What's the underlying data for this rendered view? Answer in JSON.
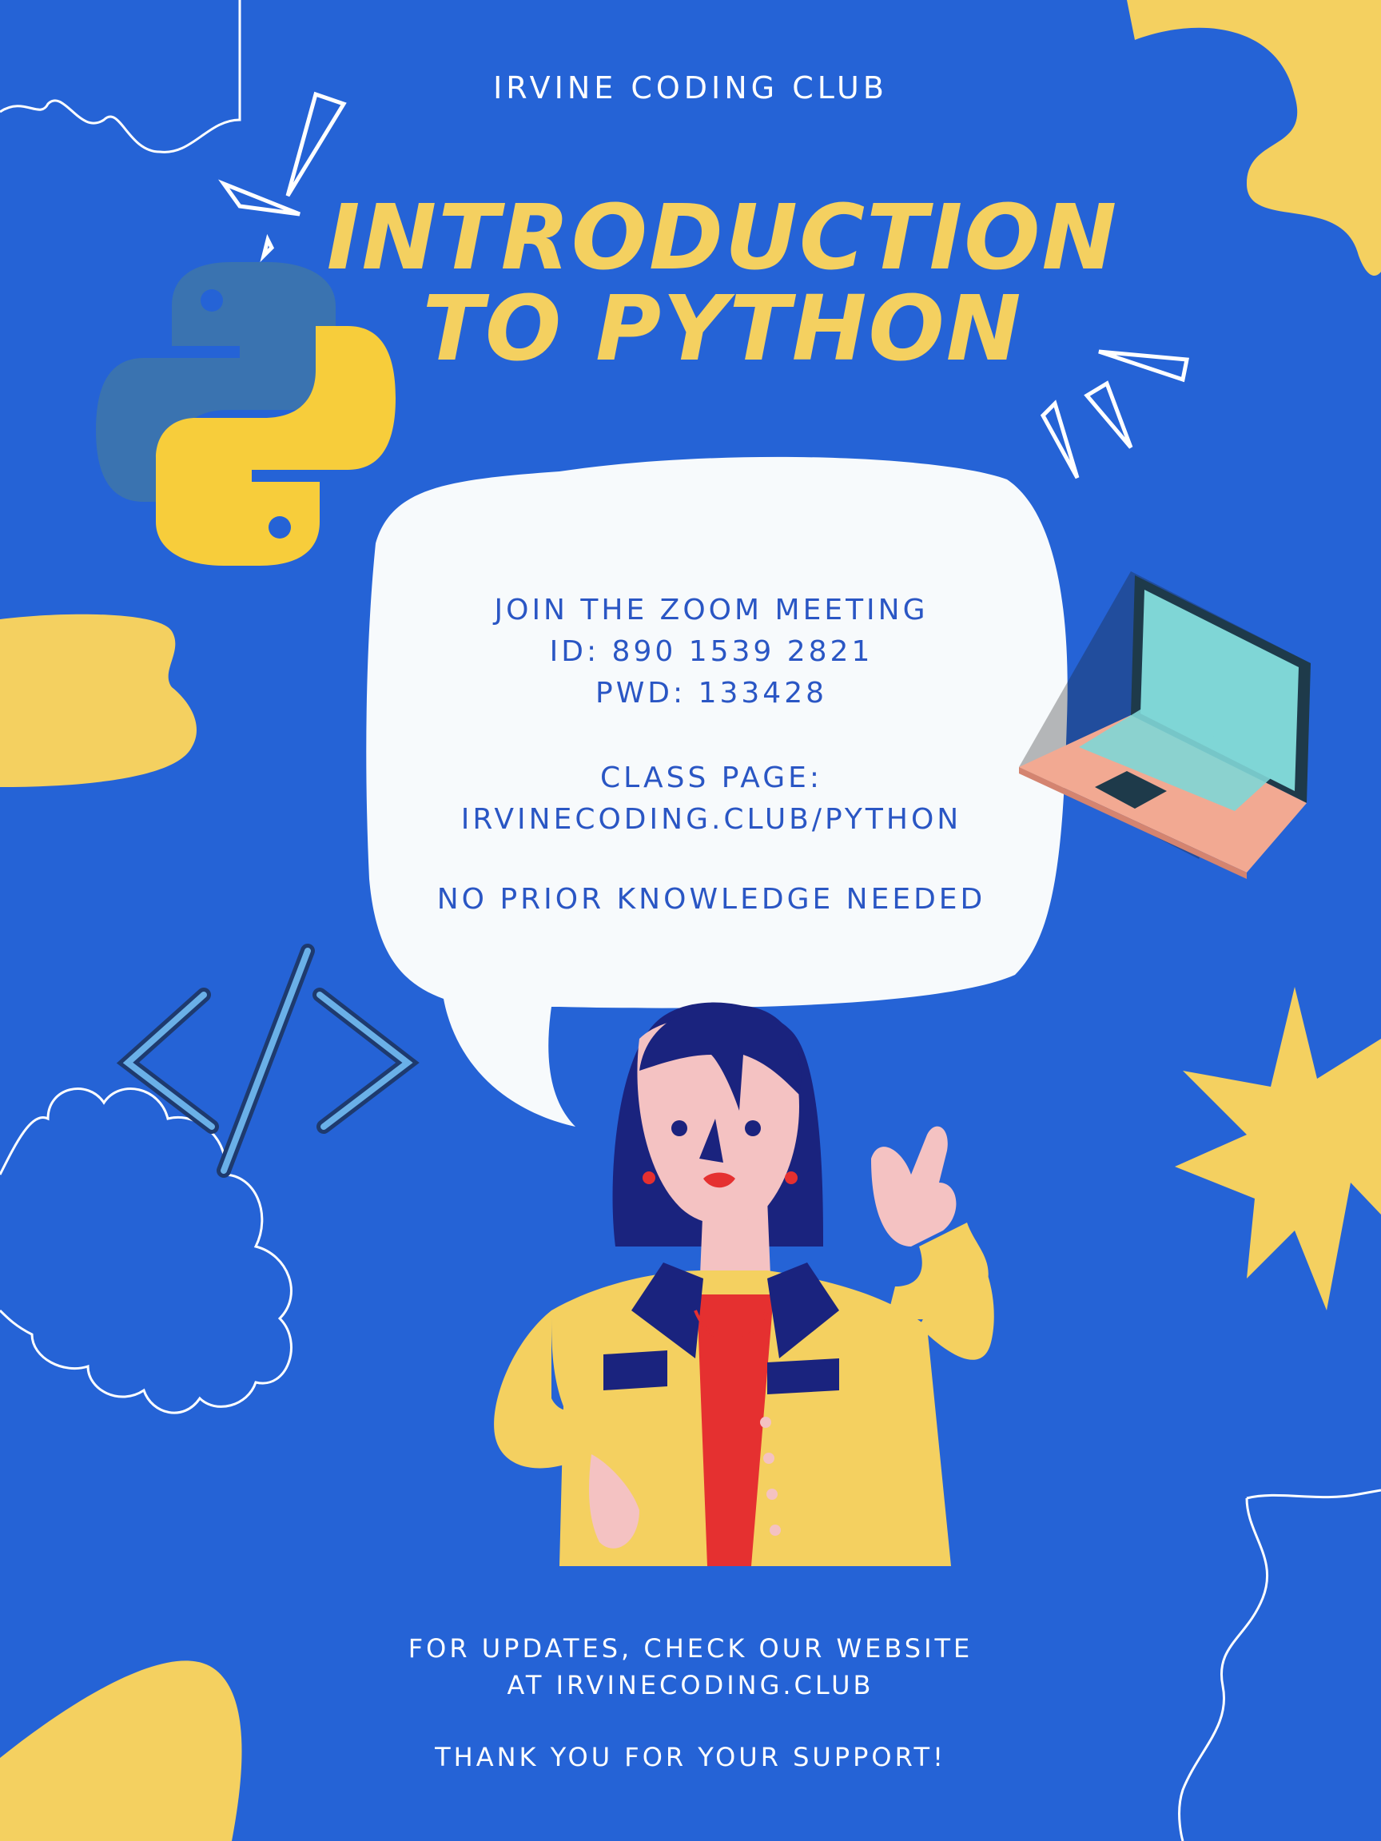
{
  "colors": {
    "background": "#2563d6",
    "accent_yellow": "#f4d060",
    "bubble": "#f7fafc",
    "bubble_text": "#2a56c4",
    "white": "#ffffff"
  },
  "header": {
    "club_name": "IRVINE CODING CLUB",
    "title_line1": "INTRODUCTION",
    "title_line2": "TO PYTHON"
  },
  "bubble": {
    "join_line": "JOIN THE ZOOM MEETING",
    "meeting_id": "ID: 890 1539 2821",
    "password": "PWD: 133428",
    "class_page_label": "CLASS PAGE:",
    "class_page_url": "IRVINECODING.CLUB/PYTHON",
    "note": "NO PRIOR KNOWLEDGE NEEDED"
  },
  "footer": {
    "updates_line1": "FOR UPDATES, CHECK OUR WEBSITE",
    "updates_line2": "AT IRVINECODING.CLUB",
    "thanks": "THANK YOU FOR YOUR SUPPORT!"
  },
  "icons": [
    "python-logo-icon",
    "laptop-icon",
    "code-brackets-icon",
    "spark-icon"
  ]
}
